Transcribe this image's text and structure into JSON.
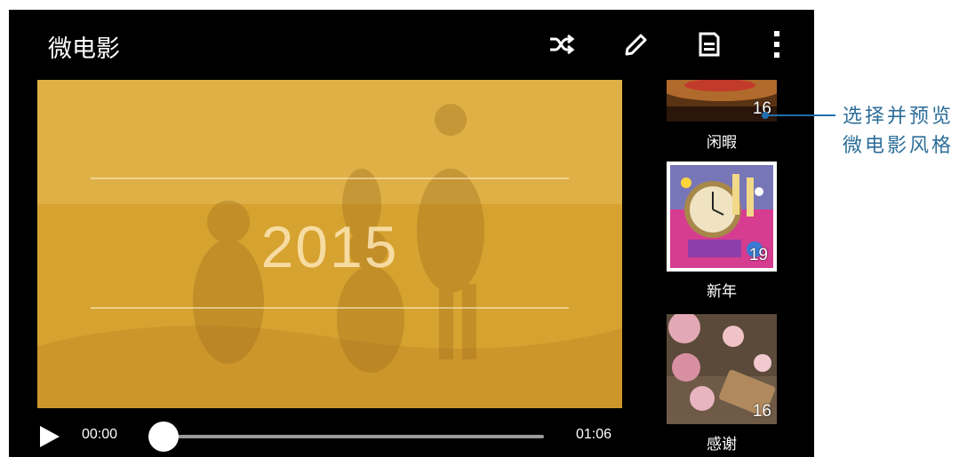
{
  "app": {
    "title": "微电影"
  },
  "toolbar": {
    "shuffle_icon": "shuffle-icon",
    "edit_icon": "pencil-icon",
    "save_icon": "save-icon",
    "more_icon": "more-vert-icon"
  },
  "preview": {
    "year_text": "2015",
    "tint_color": "#d7a431"
  },
  "player": {
    "current_time": "00:00",
    "total_time": "01:06",
    "progress": 0
  },
  "styles": {
    "items": [
      {
        "label": "闲暇",
        "count": "16"
      },
      {
        "label": "新年",
        "count": "19",
        "selected": true
      },
      {
        "label": "感谢",
        "count": "16"
      }
    ]
  },
  "callout": {
    "line1": "选择并预览",
    "line2": "微电影风格",
    "color": "#2d6e9a"
  }
}
